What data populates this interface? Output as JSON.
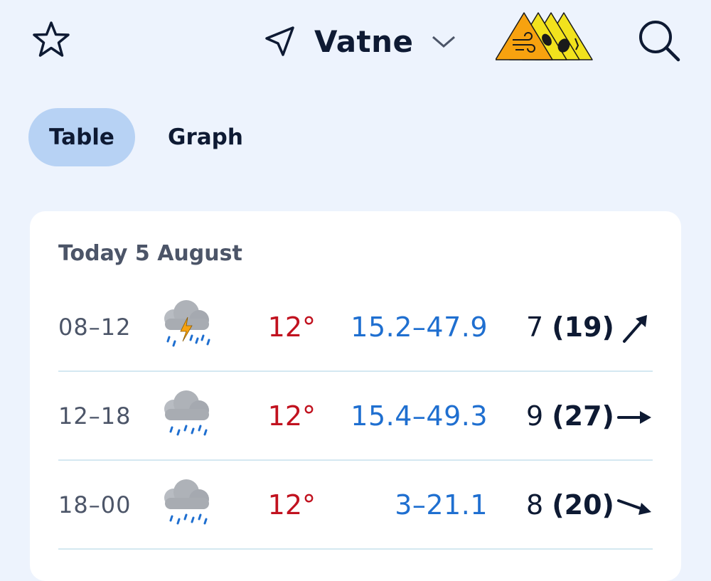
{
  "header": {
    "location": "Vatne",
    "icons": [
      "star-icon",
      "navigation-arrow-icon",
      "chevron-down-icon",
      "weather-warning-icon",
      "search-icon"
    ],
    "warning_colors": [
      "#f7a20f",
      "#f2e21d",
      "#f2e21d",
      "#f2e21d"
    ]
  },
  "tabs": [
    {
      "label": "Table",
      "active": true
    },
    {
      "label": "Graph",
      "active": false
    }
  ],
  "forecast": {
    "day_label": "Today 5 August",
    "rows": [
      {
        "period": "08–12",
        "icon": "rain-thunder-icon",
        "temp": "12°",
        "precip": "15.2–47.9",
        "wind": "7",
        "gust": "(19)",
        "direction": "north-east-arrow-icon"
      },
      {
        "period": "12–18",
        "icon": "rain-icon",
        "temp": "12°",
        "precip": "15.4–49.3",
        "wind": "9",
        "gust": "(27)",
        "direction": "east-arrow-icon"
      },
      {
        "period": "18–00",
        "icon": "rain-icon",
        "temp": "12°",
        "precip": "3–21.1",
        "wind": "8",
        "gust": "(20)",
        "direction": "south-east-arrow-icon"
      }
    ]
  },
  "colors": {
    "temperature": "#c1121f",
    "precipitation": "#1f6fd0",
    "background": "#edf3fd",
    "active_tab": "#b7d2f4"
  }
}
